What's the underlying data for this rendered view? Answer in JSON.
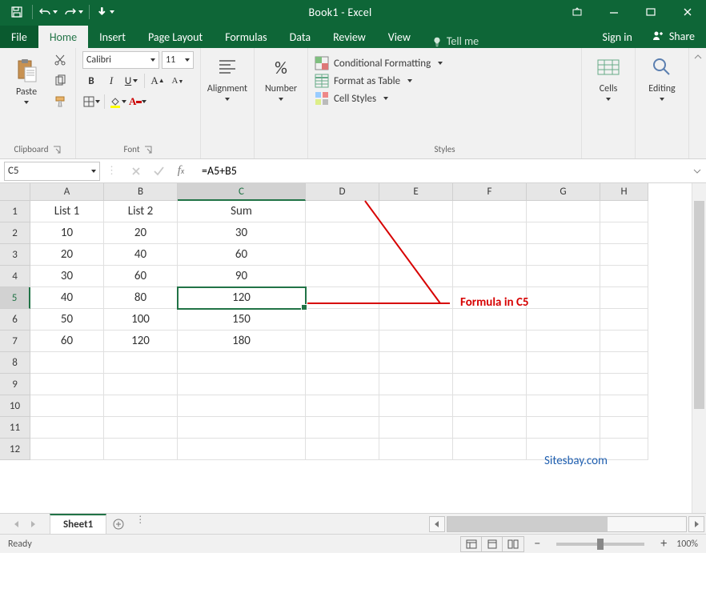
{
  "title": "Book1 - Excel",
  "tabs": {
    "file": "File",
    "home": "Home",
    "insert": "Insert",
    "page_layout": "Page Layout",
    "formulas": "Formulas",
    "data": "Data",
    "review": "Review",
    "view": "View",
    "tellme": "Tell me",
    "signin": "Sign in",
    "share": "Share"
  },
  "ribbon": {
    "clipboard": {
      "paste": "Paste",
      "label": "Clipboard"
    },
    "font": {
      "name": "Calibri",
      "size": "11",
      "bold": "B",
      "italic": "I",
      "underline": "U",
      "label": "Font"
    },
    "alignment": {
      "label": "Alignment"
    },
    "number": {
      "label": "Number"
    },
    "styles": {
      "cond": "Conditional Formatting",
      "table": "Format as Table",
      "cell": "Cell Styles",
      "label": "Styles"
    },
    "cells": {
      "label": "Cells"
    },
    "editing": {
      "label": "Editing"
    }
  },
  "namebox": "C5",
  "formula": "=A5+B5",
  "columns": [
    "A",
    "B",
    "C",
    "D",
    "E",
    "F",
    "G",
    "H"
  ],
  "rows": [
    "1",
    "2",
    "3",
    "4",
    "5",
    "6",
    "7",
    "8",
    "9",
    "10",
    "11",
    "12"
  ],
  "selected": {
    "row": 5,
    "col": 3
  },
  "cells": {
    "r1": {
      "A": "List 1",
      "B": "List 2",
      "C": "Sum"
    },
    "r2": {
      "A": "10",
      "B": "20",
      "C": "30"
    },
    "r3": {
      "A": "20",
      "B": "40",
      "C": "60"
    },
    "r4": {
      "A": "30",
      "B": "60",
      "C": "90"
    },
    "r5": {
      "A": "40",
      "B": "80",
      "C": "120"
    },
    "r6": {
      "A": "50",
      "B": "100",
      "C": "150"
    },
    "r7": {
      "A": "60",
      "B": "120",
      "C": "180"
    }
  },
  "annotation": "Formula in C5",
  "watermark": "Sitesbay.com",
  "sheet": {
    "name": "Sheet1"
  },
  "status": {
    "ready": "Ready",
    "zoom": "100%"
  }
}
